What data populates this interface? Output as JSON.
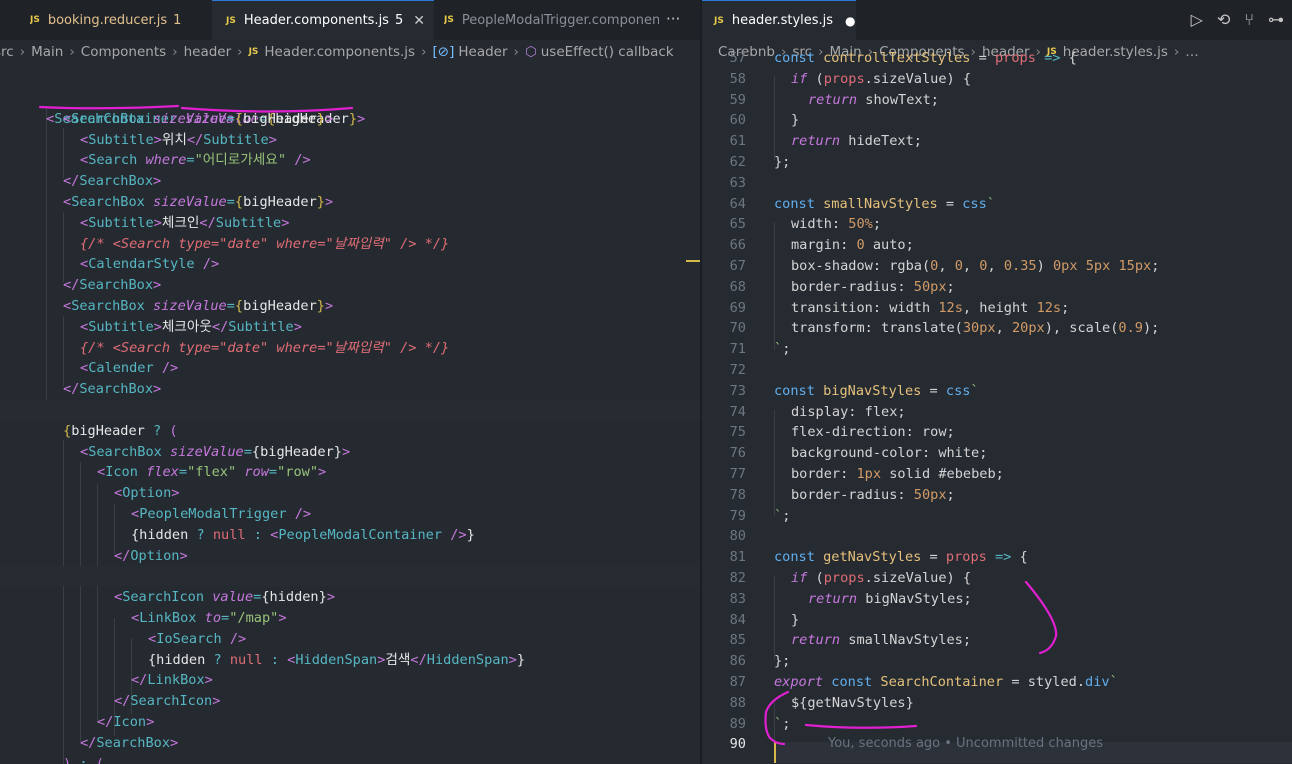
{
  "colors": {
    "accent": "#2b7bd6",
    "ink": "#e020d0",
    "bg": "#262b32"
  },
  "left": {
    "tabs": [
      {
        "label": "booking.reducer.js",
        "badge": "1",
        "icon": "js-file-icon"
      },
      {
        "label": "Header.components.js",
        "badge": "5",
        "icon": "js-file-icon",
        "active": true
      },
      {
        "label": "PeopleModalTrigger.componen",
        "icon": "js-file-icon"
      }
    ],
    "more": "···",
    "breadcrumb": [
      "src",
      "Main",
      "Components",
      "header",
      "Header.components.js",
      "Header",
      "useEffect() callback"
    ],
    "lines": [
      "<SearchContainer sizeValue={bigHeader}>",
      "<SearchBox sizeValue={bigHeader}>",
      "<Subtitle>위치</Subtitle>",
      "<Search where=\"어디로가세요\" />",
      "</SearchBox>",
      "<SearchBox sizeValue={bigHeader}>",
      "<Subtitle>체크인</Subtitle>",
      "{/* <Search type=\"date\" where=\"날짜입력\" /> */}",
      "<CalendarStyle />",
      "</SearchBox>",
      "<SearchBox sizeValue={bigHeader}>",
      "<Subtitle>체크아웃</Subtitle>",
      "{/* <Search type=\"date\" where=\"날짜입력\" /> */}",
      "<Calender />",
      "</SearchBox>",
      "",
      "{bigHeader ? (",
      "<SearchBox sizeValue={bigHeader}>",
      "<Icon flex=\"flex\" row=\"row\">",
      "<Option>",
      "<PeopleModalTrigger />",
      "{hidden ? null : <PeopleModalContainer />}",
      "</Option>",
      "",
      "<SearchIcon value={hidden}>",
      "<LinkBox to=\"/map\">",
      "<IoSearch />",
      "{hidden ? null : <HiddenSpan>검색</HiddenSpan>}",
      "</LinkBox>",
      "</SearchIcon>",
      "</Icon>",
      "</SearchBox>",
      ") : ("
    ]
  },
  "right": {
    "tab": {
      "label": "header.styles.js",
      "icon": "js-file-icon",
      "dirty": "●"
    },
    "actions": [
      "▷",
      "⟲",
      "⑂",
      "⊶"
    ],
    "breadcrumb": [
      "Carebnb",
      "src",
      "Main",
      "Components",
      "header",
      "header.styles.js",
      "…"
    ],
    "line_numbers": [
      "57",
      "58",
      "59",
      "60",
      "61",
      "62",
      "63",
      "64",
      "65",
      "66",
      "67",
      "68",
      "69",
      "70",
      "71",
      "72",
      "73",
      "74",
      "75",
      "76",
      "77",
      "78",
      "79",
      "80",
      "81",
      "82",
      "83",
      "84",
      "85",
      "86",
      "87",
      "88",
      "89",
      "90"
    ],
    "lines": [
      "const controllTextStyles = props => {",
      "if (props.sizeValue) {",
      "return showText;",
      "}",
      "return hideText;",
      "};",
      "",
      "const smallNavStyles = css`",
      "width: 50%;",
      "margin: 0 auto;",
      "box-shadow: rgba(0, 0, 0, 0.35) 0px 5px 15px;",
      "border-radius: 50px;",
      "transition: width 12s, height 12s;",
      "transform: translate(30px, 20px), scale(0.9);",
      "`;",
      "",
      "const bigNavStyles = css`",
      "display: flex;",
      "flex-direction: row;",
      "background-color: white;",
      "border: 1px solid #ebebeb;",
      "border-radius: 50px;",
      "`;",
      "",
      "const getNavStyles = props => {",
      "if (props.sizeValue) {",
      "return bigNavStyles;",
      "}",
      "return smallNavStyles;",
      "};",
      "export const SearchContainer = styled.div`",
      "${getNavStyles}",
      "`;",
      ""
    ],
    "blame": "You, seconds ago • Uncommitted changes"
  }
}
